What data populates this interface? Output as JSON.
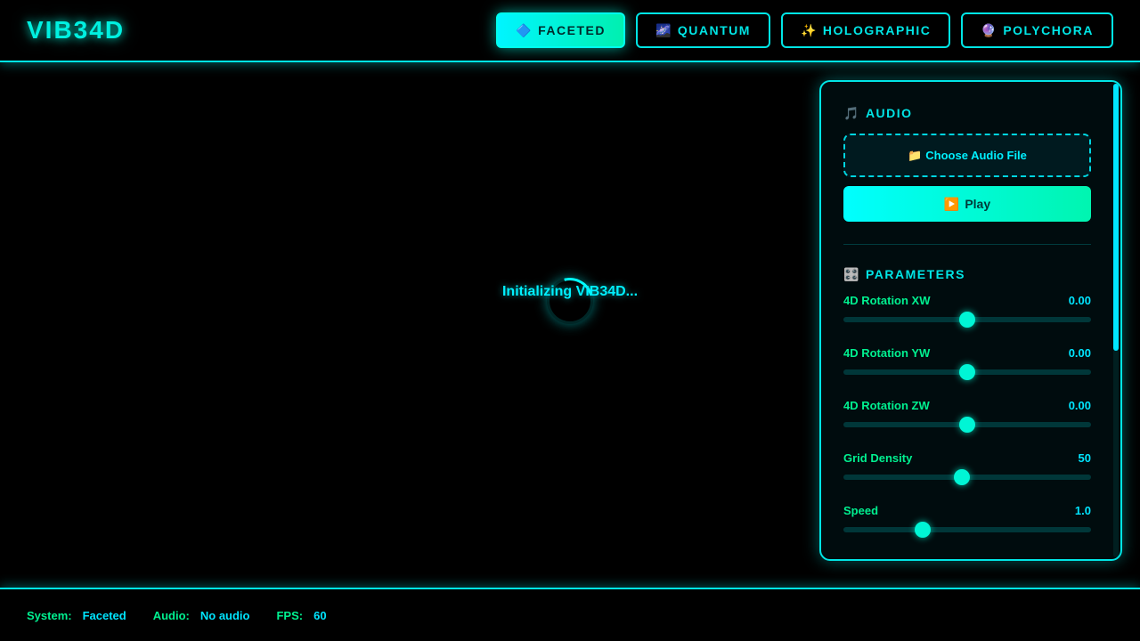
{
  "app": {
    "title": "VIB34D"
  },
  "tabs": [
    {
      "icon": "🔷",
      "icon_name": "blue-diamond-icon",
      "label": "FACETED",
      "active": true
    },
    {
      "icon": "🌌",
      "icon_name": "galaxy-icon",
      "label": "QUANTUM",
      "active": false
    },
    {
      "icon": "✨",
      "icon_name": "sparkles-icon",
      "label": "HOLOGRAPHIC",
      "active": false
    },
    {
      "icon": "🔮",
      "icon_name": "crystal-ball-icon",
      "label": "POLYCHORA",
      "active": false
    }
  ],
  "stage": {
    "loading_text": "Initializing VIB34D..."
  },
  "audio": {
    "icon": "🎵",
    "title": "AUDIO",
    "file_icon": "📁",
    "file_label": "Choose Audio File",
    "play_icon": "▶️",
    "play_label": "Play"
  },
  "parameters": {
    "icon": "🎛️",
    "title": "PARAMETERS",
    "items": [
      {
        "label": "4D Rotation XW",
        "value": "0.00",
        "fraction": 0.5
      },
      {
        "label": "4D Rotation YW",
        "value": "0.00",
        "fraction": 0.5
      },
      {
        "label": "4D Rotation ZW",
        "value": "0.00",
        "fraction": 0.5
      },
      {
        "label": "Grid Density",
        "value": "50",
        "fraction": 0.48
      },
      {
        "label": "Speed",
        "value": "1.0",
        "fraction": 0.32
      }
    ]
  },
  "status": {
    "system_label": "System:",
    "system_value": "Faceted",
    "audio_label": "Audio:",
    "audio_value": "No audio",
    "fps_label": "FPS:",
    "fps_value": "60"
  },
  "colors": {
    "accent": "#00e5e5",
    "accent_green": "#00f090",
    "background": "#000000"
  }
}
